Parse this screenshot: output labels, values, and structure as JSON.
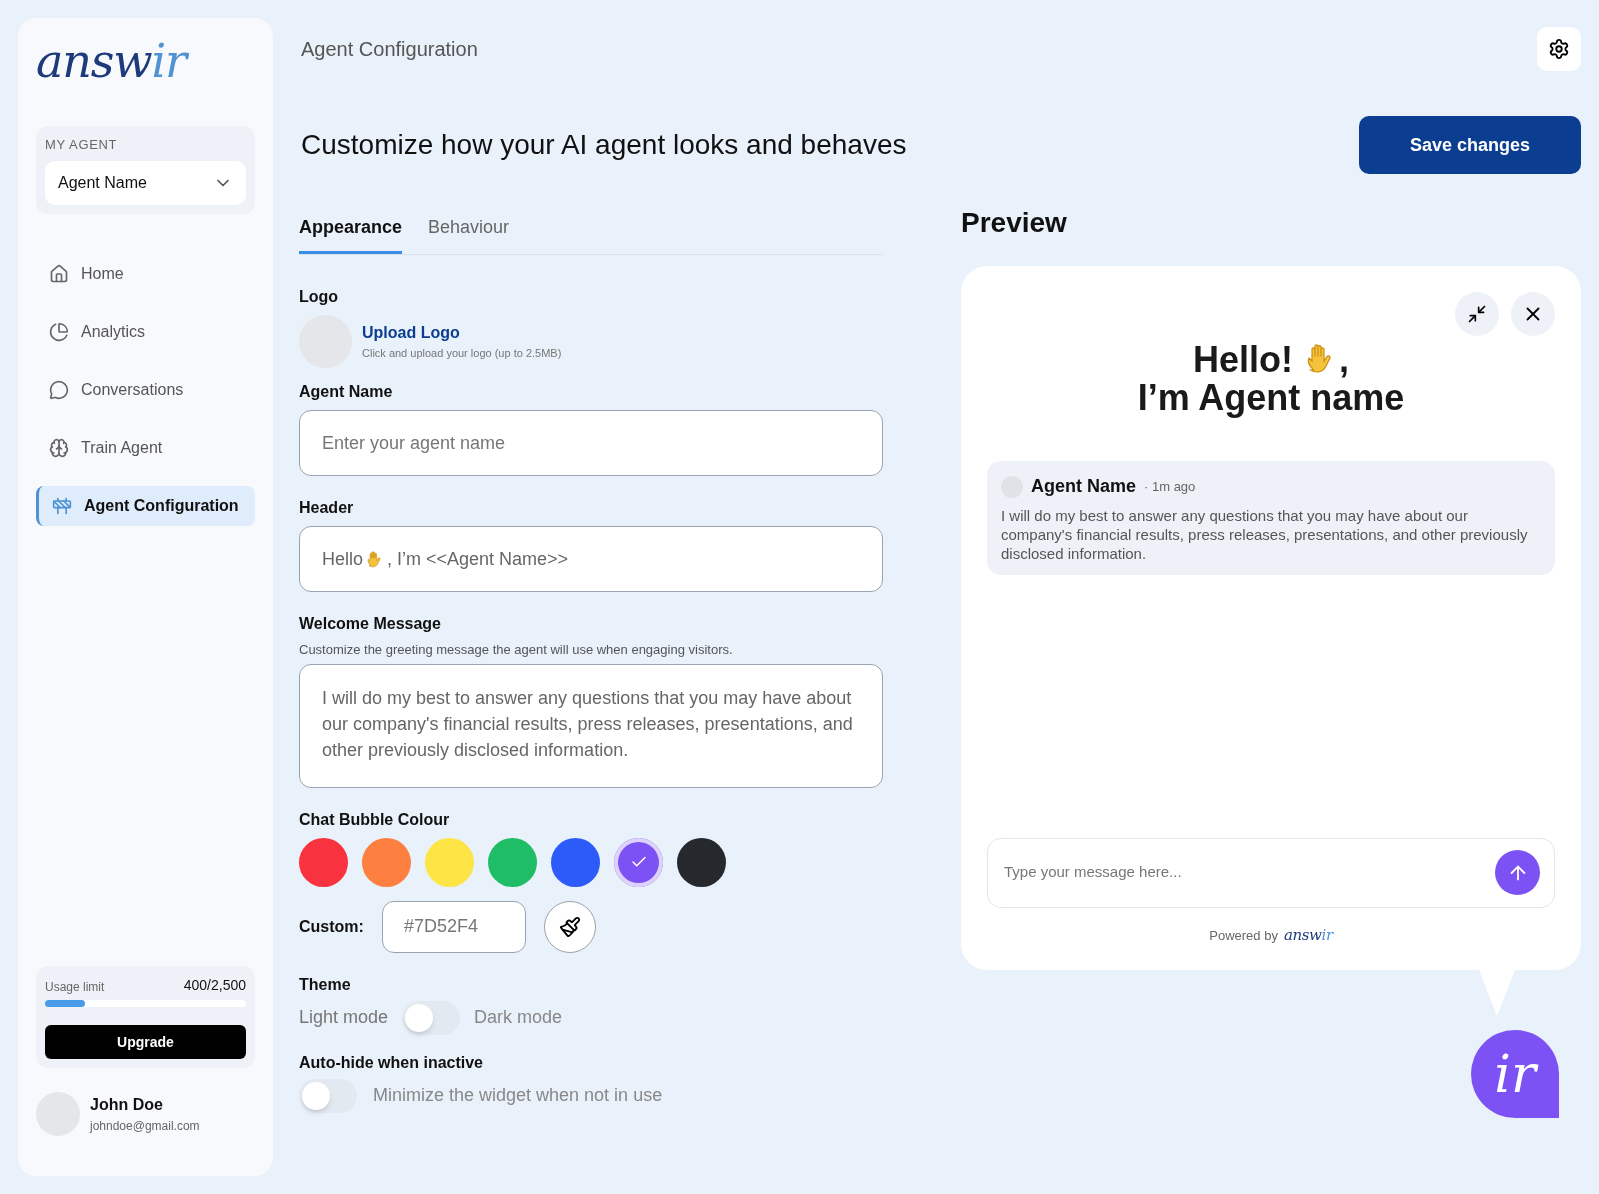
{
  "logo": {
    "main": "answ",
    "accent": "ir"
  },
  "agent_picker": {
    "label": "MY AGENT",
    "value": "Agent Name"
  },
  "nav": [
    {
      "label": "Home",
      "selected": false
    },
    {
      "label": "Analytics",
      "selected": false
    },
    {
      "label": "Conversations",
      "selected": false
    },
    {
      "label": "Train Agent",
      "selected": false
    },
    {
      "label": "Agent Configuration",
      "selected": true
    }
  ],
  "usage": {
    "label": "Usage limit",
    "reading": "400/2,500",
    "level": 0.2,
    "button": "Upgrade"
  },
  "user": {
    "name": "John Doe",
    "email": "johndoe@gmail.com"
  },
  "page_title": "Agent Configuration",
  "heading": "Customize how your AI agent looks and behaves",
  "save_button": "Save changes",
  "tabs": [
    {
      "label": "Appearance",
      "selected": true
    },
    {
      "label": "Behaviour",
      "selected": false
    }
  ],
  "logo_field": {
    "label": "Logo",
    "link": "Upload Logo",
    "hint": "Click and upload your logo (up to 2.5MB)"
  },
  "agent_name": {
    "label": "Agent Name",
    "placeholder": "Enter your agent name"
  },
  "header": {
    "label": "Header",
    "value_before": "Hello",
    "value_after": ", I’m <<Agent Name>>"
  },
  "welcome": {
    "label": "Welcome Message",
    "hint": "Customize the greeting message the agent will use when engaging visitors.",
    "value": "I will do my best to answer any questions that you may have about our company's financial results, press releases, presentations, and other previously disclosed information."
  },
  "bubble": {
    "label": "Chat Bubble Colour",
    "swatches": [
      {
        "color": "#f8323f",
        "selected": false
      },
      {
        "color": "#fe8040",
        "selected": false
      },
      {
        "color": "#fde545",
        "selected": false
      },
      {
        "color": "#1fbd66",
        "selected": false
      },
      {
        "color": "#2d5bf9",
        "selected": false
      },
      {
        "color": "#7d52f4",
        "selected": true
      },
      {
        "color": "#25282c",
        "selected": false
      }
    ],
    "custom_label": "Custom:",
    "custom_value": "#7D52F4"
  },
  "theme": {
    "label": "Theme",
    "off_label": "Light mode",
    "on_label": "Dark mode",
    "on": false
  },
  "auto_hide": {
    "label": "Auto-hide when inactive",
    "description": "Minimize the widget when not in use",
    "on": false
  },
  "preview": {
    "title": "Preview",
    "greeting_start": "Hello!",
    "greeting_end": ",",
    "greeting_line_2": "I’m Agent name",
    "message": {
      "sender": "Agent Name",
      "time": "· 1m ago",
      "text": "I will do my best to answer any questions that you may have about our company's financial results, press releases, presentations, and other previously disclosed information."
    },
    "input_placeholder": "Type your message here...",
    "powered_by": "Powered by",
    "brand": {
      "main": "answ",
      "accent": "ir"
    },
    "launcher": "ir"
  }
}
